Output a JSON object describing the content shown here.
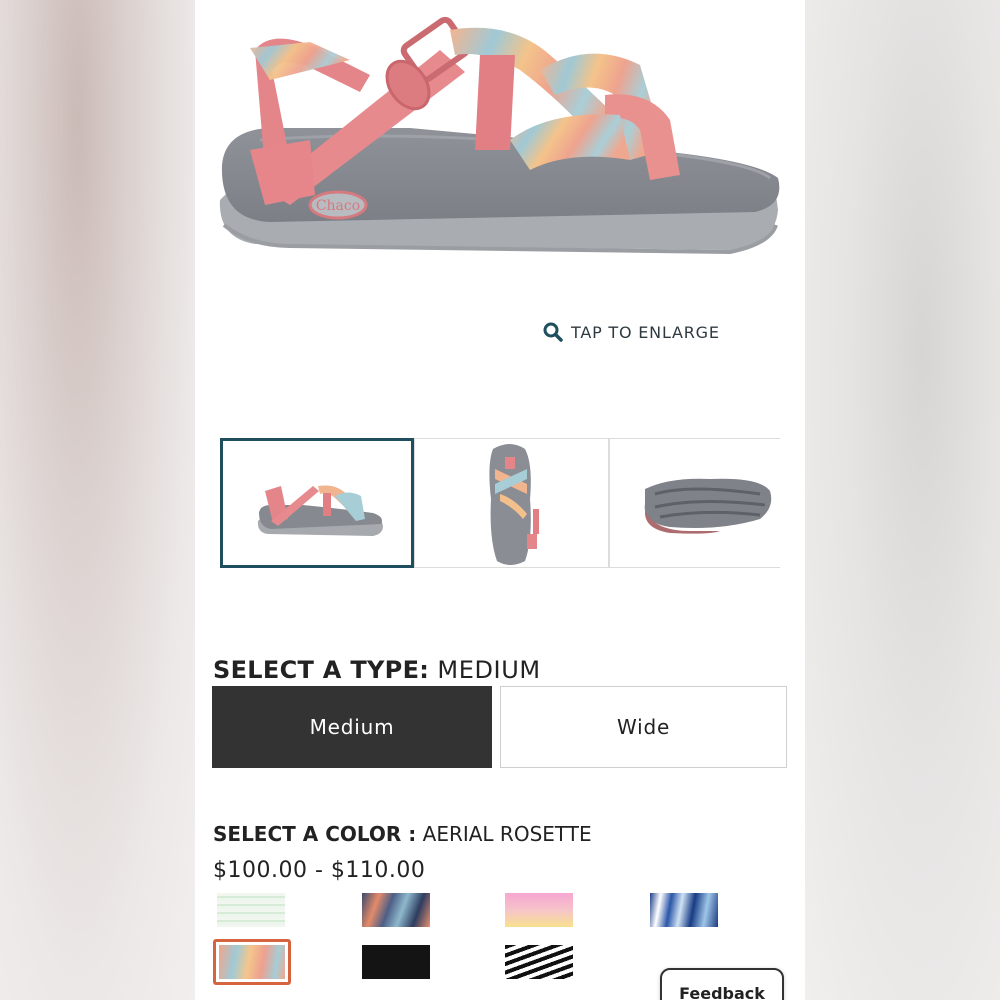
{
  "enlarge": {
    "label": "TAP TO ENLARGE",
    "icon": "search-icon"
  },
  "hero": {
    "brand_logo": "Chaco"
  },
  "thumbnails": [
    {
      "view": "side",
      "selected": true
    },
    {
      "view": "top",
      "selected": false
    },
    {
      "view": "bottom",
      "selected": false
    }
  ],
  "type_select": {
    "heading_label": "SELECT A TYPE:",
    "heading_value": " MEDIUM",
    "options": [
      "Medium",
      "Wide"
    ],
    "selected": "Medium"
  },
  "color_select": {
    "heading_label": "SELECT A COLOR :",
    "heading_value": " AERIAL ROSETTE",
    "price": "$100.00 - $110.00",
    "selected_index": 4
  },
  "feedback": {
    "label": "Feedback"
  },
  "colors": {
    "accent": "#1f4f5f",
    "selected_swatch_border": "#d4653f",
    "active_type_bg": "#333333"
  }
}
